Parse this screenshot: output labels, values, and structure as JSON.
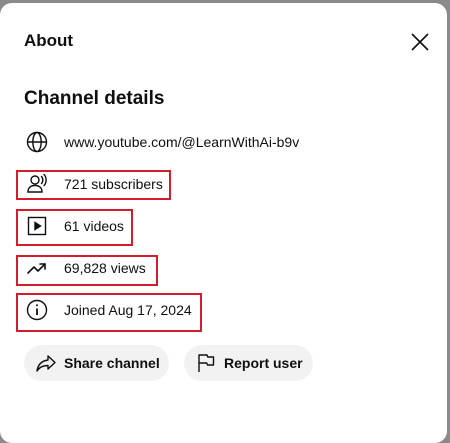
{
  "dialog": {
    "title": "About",
    "close_icon": "close-icon"
  },
  "channel_details": {
    "heading": "Channel details",
    "link": {
      "icon": "globe-icon",
      "text": "www.youtube.com/@LearnWithAi-b9v"
    },
    "subscribers": {
      "icon": "subscribers-icon",
      "text": "721 subscribers"
    },
    "videos": {
      "icon": "video-play-icon",
      "text": "61 videos"
    },
    "views": {
      "icon": "trending-icon",
      "text": "69,828 views"
    },
    "joined": {
      "icon": "info-icon",
      "text": "Joined Aug 17, 2024"
    }
  },
  "actions": {
    "share": {
      "icon": "share-icon",
      "label": "Share channel"
    },
    "report": {
      "icon": "flag-icon",
      "label": "Report user"
    }
  },
  "colors": {
    "highlight": "#d41c2c",
    "button_bg": "#f2f2f2",
    "text": "#0f0f0f"
  }
}
